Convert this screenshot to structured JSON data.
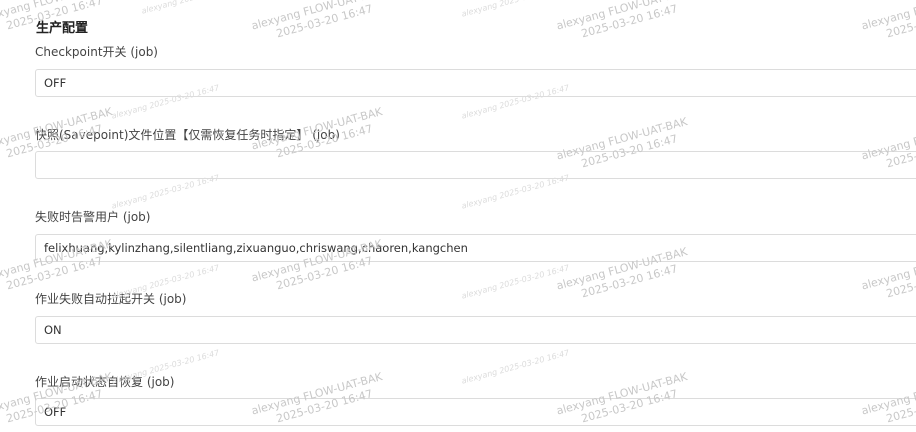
{
  "section": {
    "title": "生产配置"
  },
  "fields": [
    {
      "label": "Checkpoint开关 (job)",
      "value": "OFF"
    },
    {
      "label": "快照(Savepoint)文件位置【仅需恢复任务时指定】 (job)",
      "value": ""
    },
    {
      "label": "失败时告警用户 (job)",
      "value": "felixhuang,kylinzhang,silentliang,zixuanguo,chriswang,chaoren,kangchen"
    },
    {
      "label": "作业失败自动拉起开关 (job)",
      "value": "ON"
    },
    {
      "label": "作业启动状态自恢复 (job)",
      "value": "OFF"
    }
  ],
  "watermark": {
    "user_line": "alexyang FLOW-UAT-BAK",
    "time_line": "2025-03-20 16:47",
    "light_line": "alexyang 2025-03-20 16:47"
  }
}
